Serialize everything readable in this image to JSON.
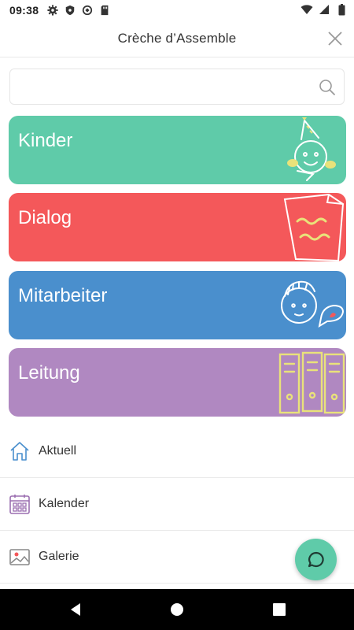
{
  "status_bar": {
    "time": "09:38",
    "left_icons": [
      "gear-icon",
      "shield-icon",
      "sync-icon",
      "sd-card-icon"
    ],
    "right_icons": [
      "wifi-icon",
      "cell-signal-icon",
      "battery-icon"
    ]
  },
  "header": {
    "title": "Crèche d’Assemble"
  },
  "search": {
    "value": "",
    "placeholder": ""
  },
  "categories": [
    {
      "label": "Kinder",
      "color": "#5fcba9"
    },
    {
      "label": "Dialog",
      "color": "#f4585a"
    },
    {
      "label": "Mitarbeiter",
      "color": "#4a8fcd"
    },
    {
      "label": "Leitung",
      "color": "#b088c1"
    }
  ],
  "menu": [
    {
      "label": "Aktuell",
      "icon": "home-icon"
    },
    {
      "label": "Kalender",
      "icon": "calendar-icon"
    },
    {
      "label": "Galerie",
      "icon": "image-icon"
    }
  ],
  "fab": {
    "icon": "chat-icon",
    "color": "#5fcba9"
  },
  "nav": {
    "icons": [
      "back-icon",
      "home-icon",
      "recents-icon"
    ]
  }
}
